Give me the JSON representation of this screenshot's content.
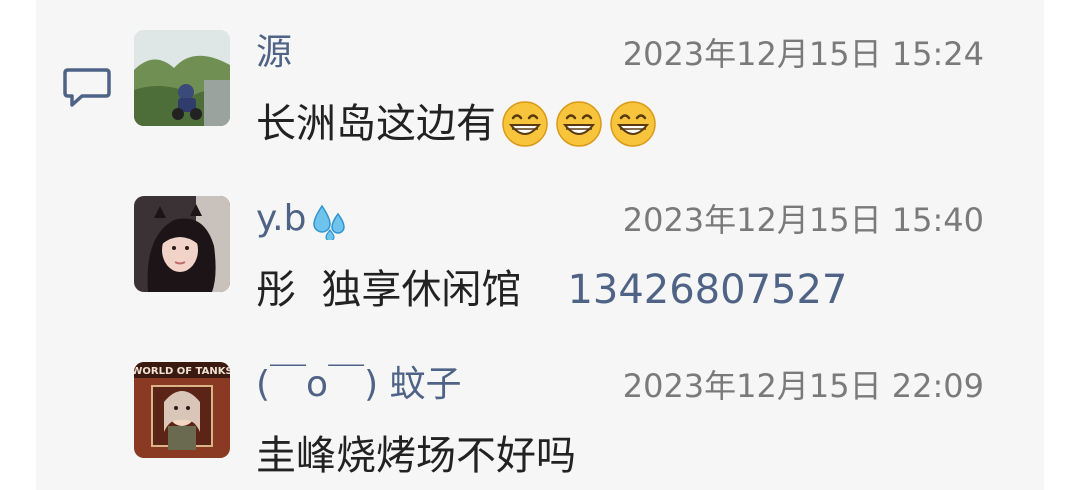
{
  "comments": [
    {
      "username": "源",
      "timestamp": "2023年12月15日 15:24",
      "text": "长洲岛这边有",
      "emojis": [
        "grinning-face",
        "grinning-face",
        "grinning-face"
      ]
    },
    {
      "username": "y.b",
      "username_emoji": "sweat-droplets",
      "timestamp": "2023年12月15日 15:40",
      "text": "彤  独享休闲馆",
      "phone": "13426807527"
    },
    {
      "username": "(￣o￣) 蚊子",
      "timestamp": "2023年12月15日 22:09",
      "text": "圭峰烧烤场不好吗",
      "avatar_text": "WORLD OF TANKS"
    }
  ],
  "colors": {
    "name": "#4f6386",
    "timestamp": "#7a7a7a",
    "text": "#222222",
    "panel": "#f6f6f6"
  }
}
